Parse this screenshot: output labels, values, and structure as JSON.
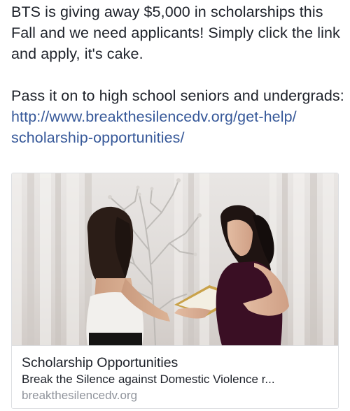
{
  "post": {
    "paragraph1": "BTS is giving away $5,000 in scholarships this Fall and we need applicants! Simply click the link and apply, it's cake.",
    "paragraph2": "Pass it on to high school seniors and undergrads:",
    "link_line1": "http://www.breakthesilencedv.org/get-help/",
    "link_line2": "scholarship-opportunities/"
  },
  "link_card": {
    "title": "Scholarship Opportunities",
    "description": "Break the Silence against Domestic Violence r...",
    "domain": "breakthesilencedv.org"
  },
  "colors": {
    "text": "#1d2129",
    "link": "#365899",
    "domain": "#90949c",
    "card_border": "#dddfe2"
  }
}
